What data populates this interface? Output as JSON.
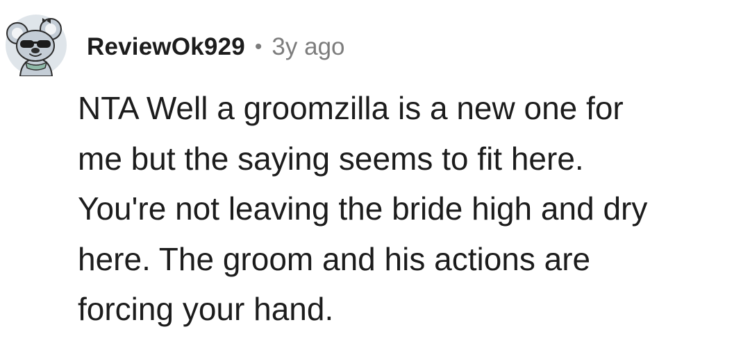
{
  "comment": {
    "author": "ReviewOk929",
    "separator": "•",
    "timestamp": "3y ago",
    "avatar_icon": "koala-with-sunglasses-avatar-icon",
    "body_lines": [
      "NTA Well a groomzilla is a new one for",
      "me but the saying seems to fit here.",
      "You're not leaving the bride high and dry",
      "here. The groom and his actions are",
      "forcing your hand."
    ]
  },
  "colors": {
    "text": "#1c1c1c",
    "muted": "#7c7c7c",
    "avatar_bg": "#dfe5ea",
    "avatar_fur": "#c4cdd6",
    "avatar_outline": "#2b2b2b",
    "scarf": "#8fb9a8"
  }
}
